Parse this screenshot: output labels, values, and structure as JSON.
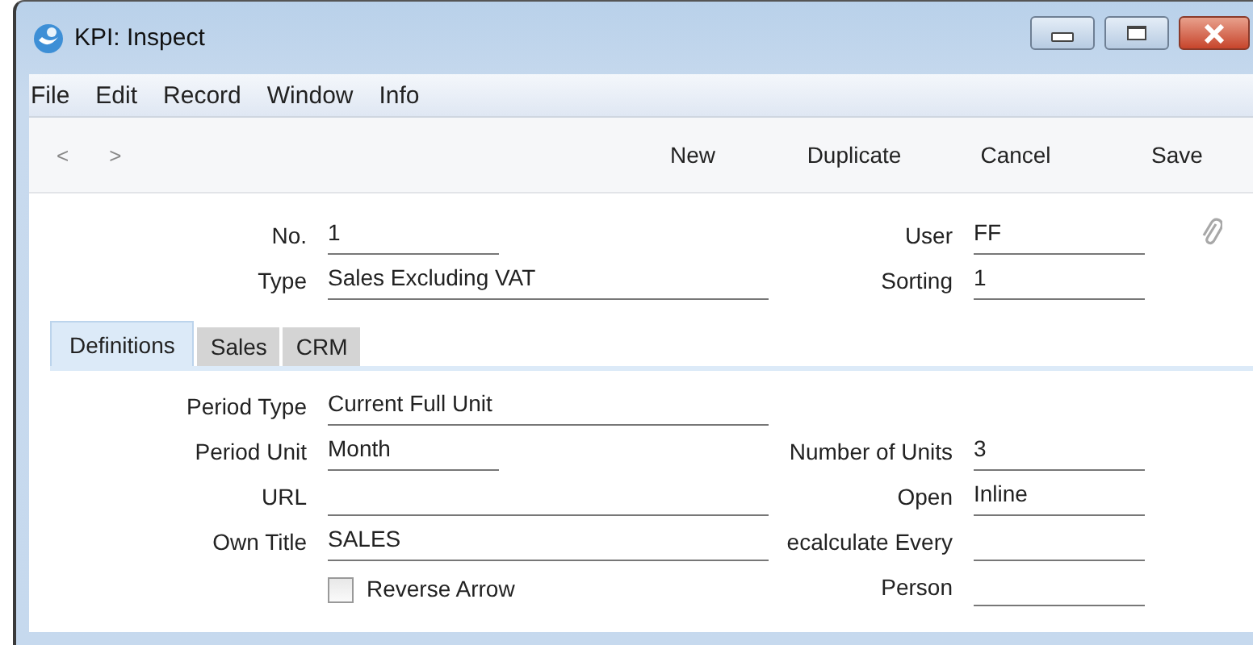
{
  "window": {
    "title": "KPI: Inspect"
  },
  "menu": [
    "File",
    "Edit",
    "Record",
    "Window",
    "Info"
  ],
  "toolbar": {
    "nav": [
      "<",
      ">"
    ],
    "buttons": [
      "New",
      "Duplicate",
      "Cancel",
      "Save"
    ]
  },
  "header_rows": [
    {
      "left": {
        "label": "No.",
        "value": "1",
        "wide": false
      },
      "right": {
        "label": "User",
        "value": "FF"
      }
    },
    {
      "left": {
        "label": "Type",
        "value": "Sales Excluding VAT",
        "wide": true
      },
      "right": {
        "label": "Sorting",
        "value": "1"
      }
    }
  ],
  "tabs": [
    {
      "label": "Definitions",
      "selected": true
    },
    {
      "label": "Sales",
      "selected": false
    },
    {
      "label": "CRM",
      "selected": false
    }
  ],
  "form_rows": [
    {
      "left": {
        "kind": "field",
        "label": "Period Type",
        "value": "Current Full Unit",
        "wide": true
      }
    },
    {
      "left": {
        "kind": "field",
        "label": "Period Unit",
        "value": "Month",
        "wide": false
      },
      "right": {
        "label": "Number of Units",
        "value": "3"
      }
    },
    {
      "left": {
        "kind": "field",
        "label": "URL",
        "wide": true
      },
      "right": {
        "label": "Open",
        "value": "Inline"
      }
    },
    {
      "left": {
        "kind": "field",
        "label": "Own Title",
        "value": "SALES",
        "wide": true
      },
      "right": {
        "label": "ecalculate Every"
      }
    },
    {
      "left": {
        "kind": "checkbox",
        "label": "Reverse Arrow",
        "checked": false
      },
      "right": {
        "label": "Person"
      }
    }
  ]
}
